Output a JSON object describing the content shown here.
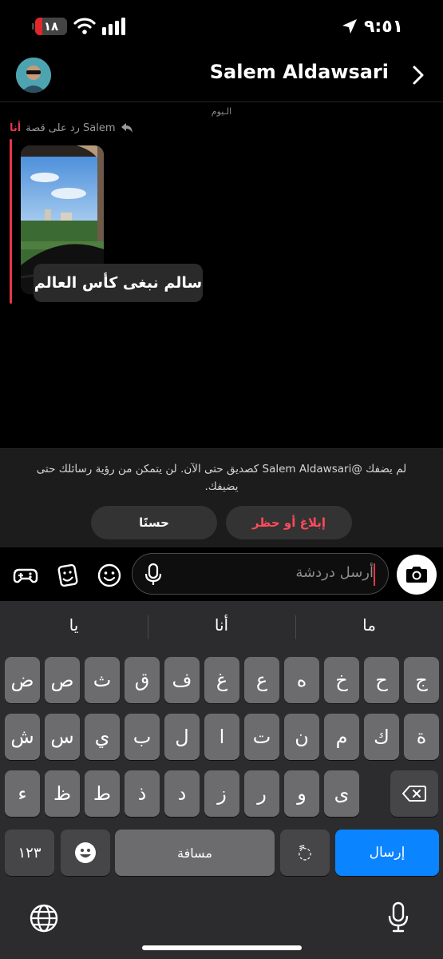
{
  "status_bar": {
    "time": "٩:٥١",
    "battery_level": "١٨",
    "icons": [
      "battery-icon",
      "wifi-icon",
      "signal-icon",
      "location-arrow-icon"
    ]
  },
  "header": {
    "contact_name": "Salem Aldawsari",
    "icons": [
      "avatar",
      "chevron-right-icon"
    ]
  },
  "chat": {
    "day_label": "الـيوم",
    "sender_label": "أنا",
    "reply_context": "رد على قصة Salem",
    "story_caption": "سالم نبغى كأس العالم"
  },
  "notice": {
    "text": "لم يضفك @Salem Aldawsari كصديق حتى الآن. لن يتمكن من رؤية رسائلك حتى يضيفك.",
    "report_button": "إبلاغ أو حظر",
    "ok_button": "حسنًا"
  },
  "input_bar": {
    "placeholder": "أرسل دردشة",
    "icons": [
      "game-controller-icon",
      "sticker-icon",
      "emoji-icon",
      "microphone-icon",
      "camera-icon"
    ]
  },
  "keyboard": {
    "suggestions": [
      "يا",
      "أنا",
      "ما"
    ],
    "row1": [
      "ض",
      "ص",
      "ث",
      "ق",
      "ف",
      "غ",
      "ع",
      "ه",
      "خ",
      "ح",
      "ج"
    ],
    "row2": [
      "ش",
      "س",
      "ي",
      "ب",
      "ل",
      "ا",
      "ت",
      "ن",
      "م",
      "ك",
      "ة"
    ],
    "row3": [
      "ء",
      "ظ",
      "ط",
      "ذ",
      "د",
      "ز",
      "ر",
      "و",
      "ى"
    ],
    "numbers_key": "١٢٣",
    "space_key": "مسافة",
    "diacritic_key": "ًً◌",
    "send_key": "إرسال",
    "icons": [
      "backspace-icon",
      "emoji-key-icon",
      "globe-icon",
      "dictation-mic-icon"
    ]
  },
  "colors": {
    "accent_red": "#e5364b",
    "send_blue": "#0a84ff",
    "battery_red": "#e0262b"
  }
}
